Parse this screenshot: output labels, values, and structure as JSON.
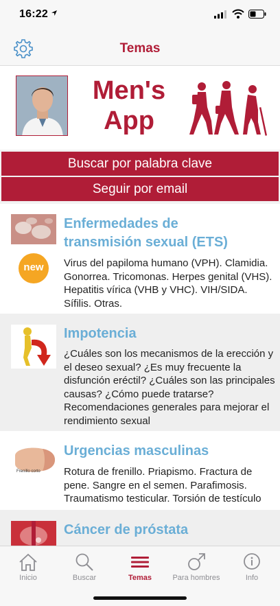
{
  "status_bar": {
    "time": "16:22"
  },
  "nav": {
    "title": "Temas",
    "settings_icon": "gear-icon"
  },
  "banner": {
    "app_name_line1": "Men's",
    "app_name_line2": "App"
  },
  "actions": {
    "search_label": "Buscar por palabra clave",
    "email_label": "Seguir por email"
  },
  "topics": [
    {
      "title_line1": "Enfermedades de",
      "title_line2": "transmisión sexual (ETS)",
      "badge": "new",
      "description": "Virus del papiloma humano (VPH). Clamidia. Gonorrea. Tricomonas. Herpes genital (VHS). Hepatitis vírica (VHB y VHC). VIH/SIDA. Sífilis. Otras."
    },
    {
      "title_line1": "Impotencia",
      "description": "¿Cuáles son los mecanismos de la erección y el deseo sexual? ¿Es muy frecuente la disfunción eréctil? ¿Cuáles son las principales causas? ¿Cómo puede tratarse? Recomendaciones generales para mejorar el rendimiento sexual"
    },
    {
      "title_line1": "Urgencias masculinas",
      "image_caption": "Frenillo corto",
      "description": "Rotura de frenillo. Priapismo. Fractura de pene. Sangre en el semen. Parafimosis. Traumatismo testicular. Torsión de testículo"
    },
    {
      "title_line1": "Cáncer de próstata"
    }
  ],
  "tabs": [
    {
      "label": "Inicio",
      "icon": "home-icon",
      "active": false
    },
    {
      "label": "Buscar",
      "icon": "search-icon",
      "active": false
    },
    {
      "label": "Temas",
      "icon": "list-icon",
      "active": true
    },
    {
      "label": "Para hombres",
      "icon": "male-symbol-icon",
      "active": false
    },
    {
      "label": "Info",
      "icon": "info-icon",
      "active": false
    }
  ],
  "colors": {
    "brand_red": "#b01d37",
    "title_blue": "#6aaed6",
    "badge_orange": "#f5a623"
  }
}
